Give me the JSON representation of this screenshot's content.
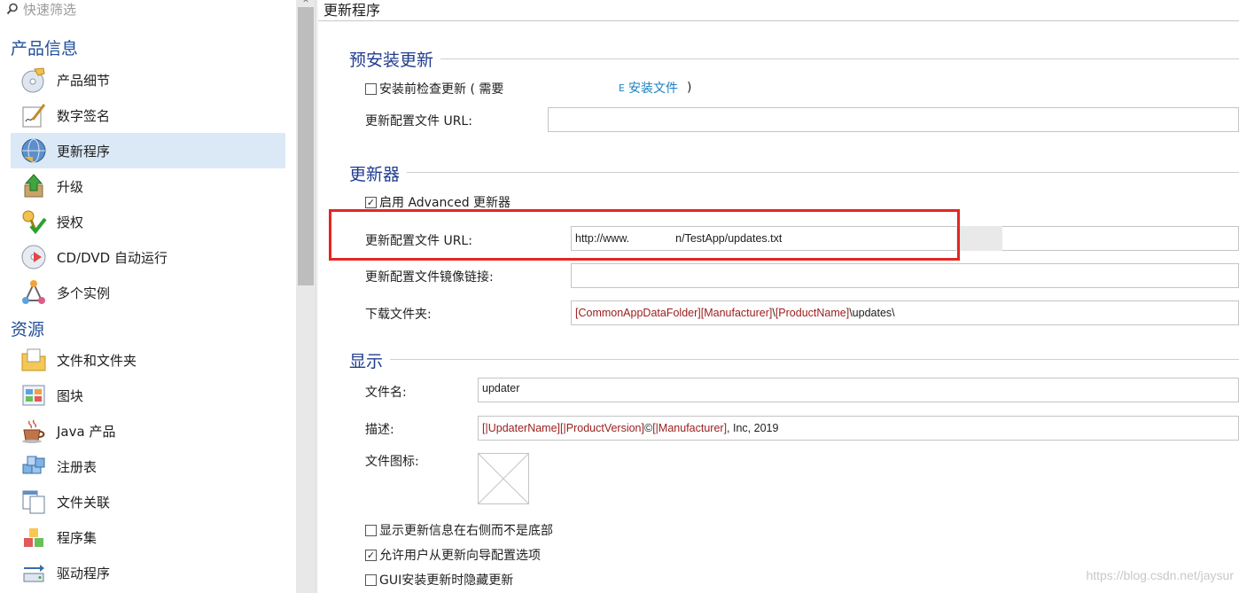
{
  "filter": {
    "placeholder": "快速筛选",
    "icon": "search-icon"
  },
  "sidebar": {
    "sections": [
      {
        "title": "产品信息"
      },
      {
        "title": "资源"
      }
    ],
    "items": [
      {
        "label": "产品细节",
        "icon": "cd-icon",
        "selected": false
      },
      {
        "label": "数字签名",
        "icon": "signature-icon",
        "selected": false
      },
      {
        "label": "更新程序",
        "icon": "globe-update-icon",
        "selected": true
      },
      {
        "label": "升级",
        "icon": "upgrade-icon",
        "selected": false
      },
      {
        "label": "授权",
        "icon": "key-check-icon",
        "selected": false
      },
      {
        "label": "CD/DVD 自动运行",
        "icon": "disc-autorun-icon",
        "selected": false
      },
      {
        "label": "多个实例",
        "icon": "instances-icon",
        "selected": false
      },
      {
        "label": "文件和文件夹",
        "icon": "folder-icon",
        "selected": false
      },
      {
        "label": "图块",
        "icon": "tiles-icon",
        "selected": false
      },
      {
        "label": "Java 产品",
        "icon": "java-cup-icon",
        "selected": false
      },
      {
        "label": "注册表",
        "icon": "registry-icon",
        "selected": false
      },
      {
        "label": "文件关联",
        "icon": "file-association-icon",
        "selected": false
      },
      {
        "label": "程序集",
        "icon": "assembly-icon",
        "selected": false
      },
      {
        "label": "驱动程序",
        "icon": "driver-icon",
        "selected": false
      }
    ]
  },
  "main": {
    "title": "更新程序",
    "preinstall": {
      "title": "预安装更新",
      "check_label": "安装前检查更新 ( 需要",
      "check_checked": false,
      "link_prefix": "E",
      "link_label": "安装文件",
      "close_paren": ")",
      "config_url_label": "更新配置文件 URL:",
      "config_url_value": ""
    },
    "updater": {
      "title": "更新器",
      "enable_label": "启用 Advanced 更新器",
      "enable_checked": true,
      "config_url_label": "更新配置文件 URL:",
      "config_url_value_start": "http://www.",
      "config_url_value_end": "n/TestApp/updates.txt",
      "mirror_label": "更新配置文件镜像链接:",
      "mirror_value": "",
      "download_label": "下载文件夹:",
      "download_tokens": [
        "[CommonAppDataFolder]",
        "[Manufacturer]",
        "\\",
        "[ProductName]",
        "\\updates\\"
      ]
    },
    "display": {
      "title": "显示",
      "filename_label": "文件名:",
      "filename_value": "updater",
      "description_label": "描述:",
      "description_tokens": [
        "[|UpdaterName]",
        " ",
        "[|ProductVersion]",
        " © ",
        "[|Manufacturer]",
        ", Inc, 2019"
      ],
      "icon_label": "文件图标:",
      "options": [
        {
          "label": "显示更新信息在右侧而不是底部",
          "checked": false
        },
        {
          "label": "允许用户从更新向导配置选项",
          "checked": true
        },
        {
          "label": "GUI安装更新时隐藏更新",
          "checked": false
        }
      ]
    }
  },
  "watermark": "https://blog.csdn.net/jaysur",
  "colors": {
    "accent": "#1f4e9a",
    "highlight": "#e52620",
    "selection": "#dbe9f7",
    "token": "#9b1c1c",
    "link": "#1a7fc1"
  }
}
